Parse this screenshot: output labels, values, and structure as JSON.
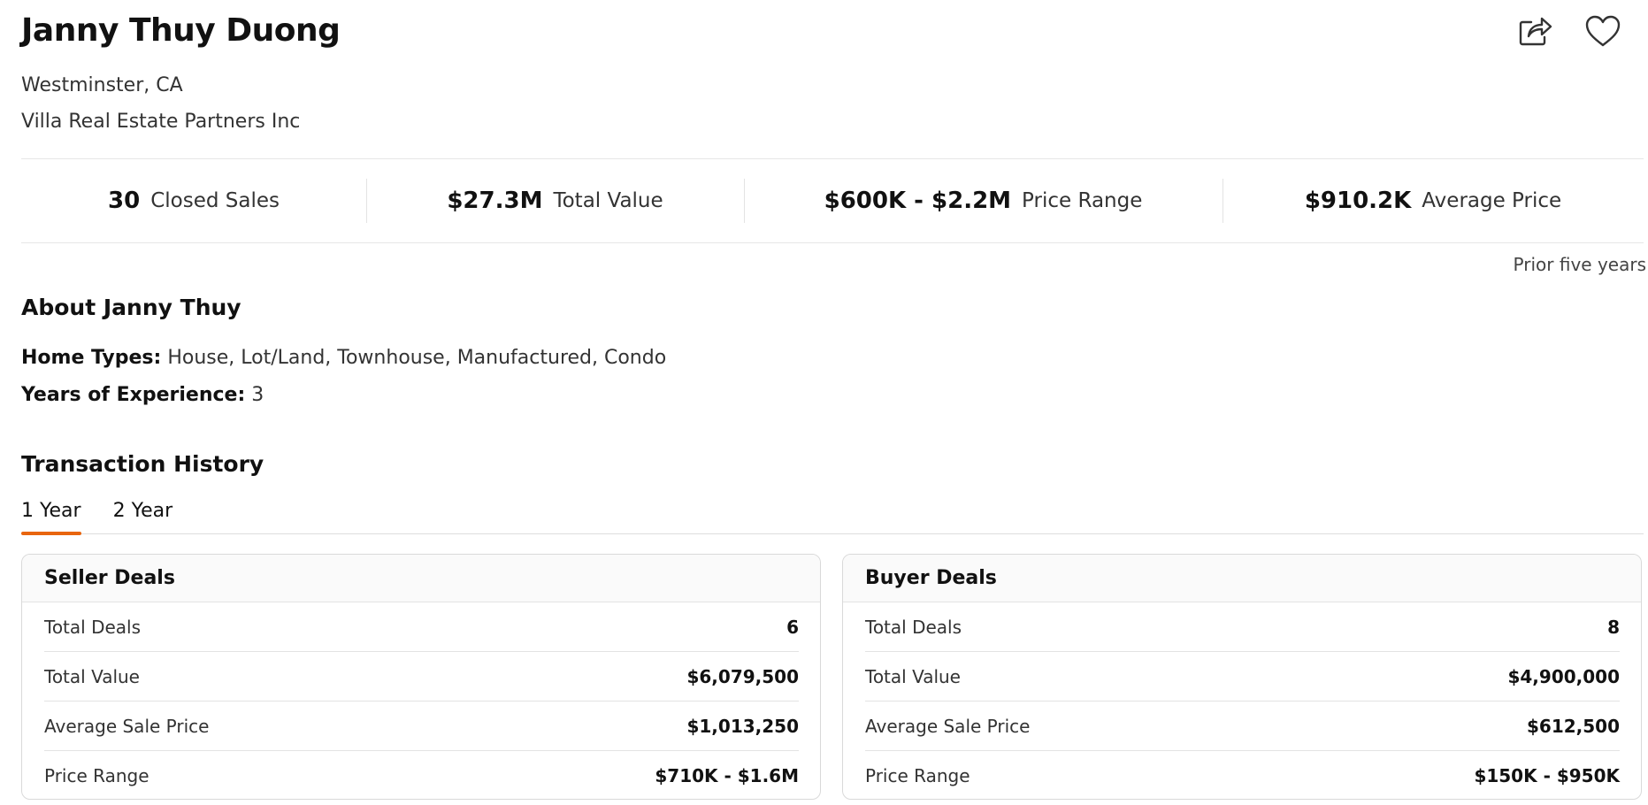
{
  "agent": {
    "name": "Janny Thuy Duong",
    "location": "Westminster, CA",
    "brokerage": "Villa Real Estate Partners Inc"
  },
  "actions": {
    "share_icon": "share-icon",
    "favorite_icon": "heart-icon"
  },
  "stats": [
    {
      "value": "30",
      "label": "Closed Sales"
    },
    {
      "value": "$27.3M",
      "label": "Total Value"
    },
    {
      "value": "$600K - $2.2M",
      "label": "Price Range"
    },
    {
      "value": "$910.2K",
      "label": "Average Price"
    }
  ],
  "stats_period": "Prior five years",
  "about": {
    "title": "About Janny Thuy",
    "home_types_label": "Home Types:",
    "home_types_value": "House, Lot/Land, Townhouse, Manufactured, Condo",
    "experience_label": "Years of Experience:",
    "experience_value": "3"
  },
  "transactions": {
    "title": "Transaction History",
    "tabs": [
      {
        "label": "1 Year",
        "active": true
      },
      {
        "label": "2 Year",
        "active": false
      }
    ],
    "seller": {
      "title": "Seller Deals",
      "rows": [
        {
          "label": "Total Deals",
          "value": "6"
        },
        {
          "label": "Total Value",
          "value": "$6,079,500"
        },
        {
          "label": "Average Sale Price",
          "value": "$1,013,250"
        },
        {
          "label": "Price Range",
          "value": "$710K - $1.6M"
        }
      ]
    },
    "buyer": {
      "title": "Buyer Deals",
      "rows": [
        {
          "label": "Total Deals",
          "value": "8"
        },
        {
          "label": "Total Value",
          "value": "$4,900,000"
        },
        {
          "label": "Average Sale Price",
          "value": "$612,500"
        },
        {
          "label": "Price Range",
          "value": "$150K - $950K"
        }
      ]
    }
  },
  "colors": {
    "accent": "#e8650e",
    "text": "#111111",
    "border": "#e3e3e3"
  }
}
